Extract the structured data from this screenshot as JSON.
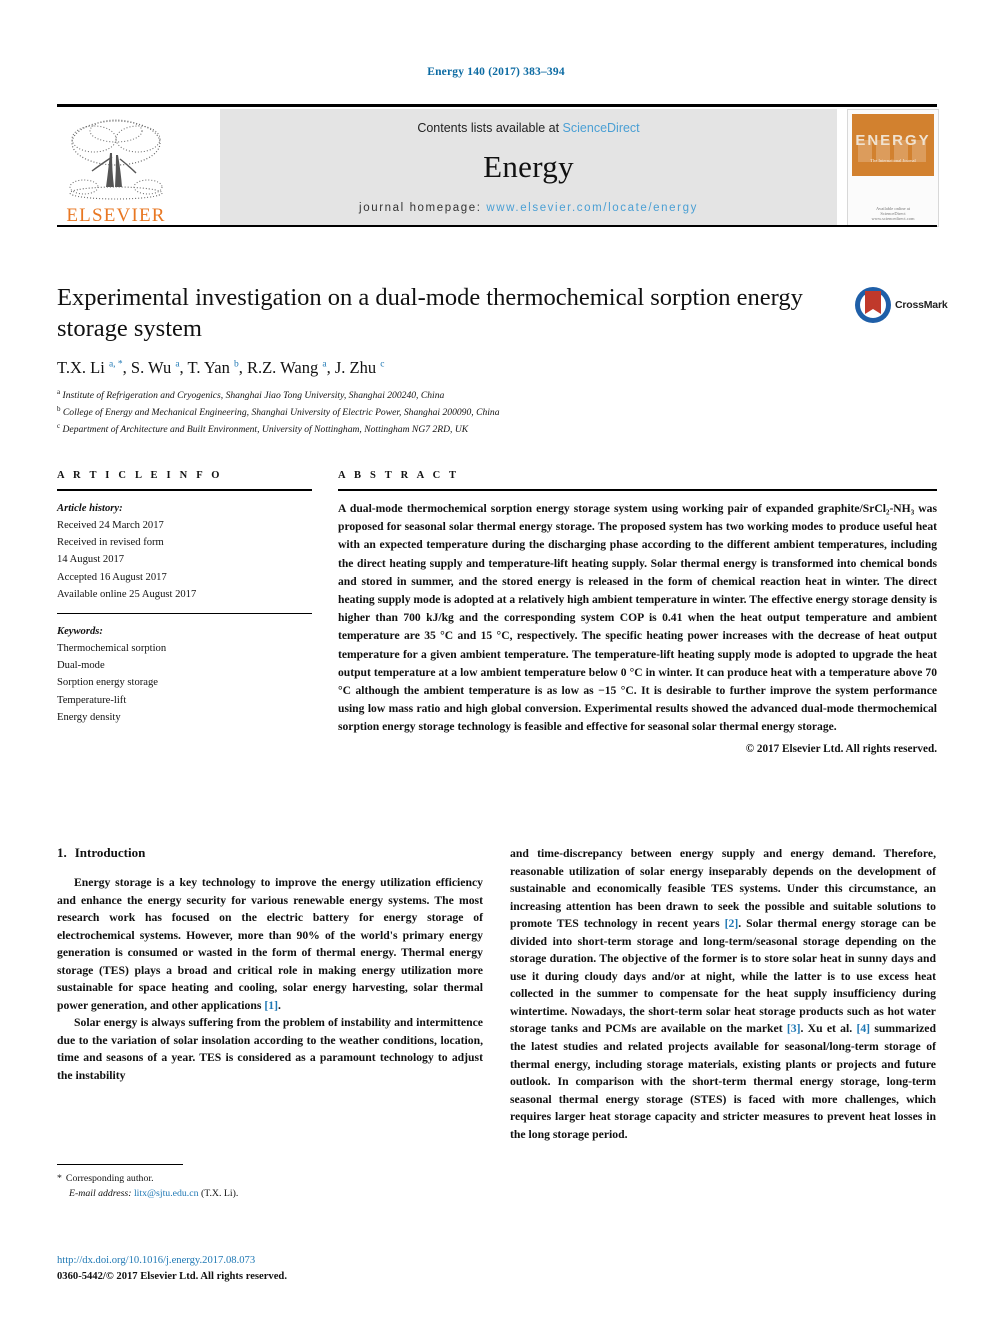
{
  "running_head": "Energy 140 (2017) 383–394",
  "masthead": {
    "contents_prefix": "Contents lists available at ",
    "contents_link": "ScienceDirect",
    "journal_title": "Energy",
    "homepage_prefix": "journal homepage: ",
    "homepage_url": "www.elsevier.com/locate/energy",
    "publisher_logo_text": "ELSEVIER",
    "cover": {
      "title": "ENERGY",
      "subtitle": "The International Journal",
      "footer": "Available online at\nScienceDirect\nwww.sciencedirect.com"
    },
    "accent_link_color": "#4a9fd4",
    "elsevier_orange": "#e87722"
  },
  "article": {
    "title": "Experimental investigation on a dual-mode thermochemical sorption energy storage system",
    "crossmark_label": "CrossMark",
    "authors_html": "T.X. Li <sup>a, *</sup>, S. Wu <sup>a</sup>, T. Yan <sup>b</sup>, R.Z. Wang <sup>a</sup>, J. Zhu <sup>c</sup>",
    "affiliations": [
      {
        "marker": "a",
        "text": "Institute of Refrigeration and Cryogenics, Shanghai Jiao Tong University, Shanghai 200240, China"
      },
      {
        "marker": "b",
        "text": "College of Energy and Mechanical Engineering, Shanghai University of Electric Power, Shanghai 200090, China"
      },
      {
        "marker": "c",
        "text": "Department of Architecture and Built Environment, University of Nottingham, Nottingham NG7 2RD, UK"
      }
    ]
  },
  "article_info": {
    "heading": "A R T I C L E   I N F O",
    "history_label": "Article history:",
    "history": [
      "Received 24 March 2017",
      "Received in revised form",
      "14 August 2017",
      "Accepted 16 August 2017",
      "Available online 25 August 2017"
    ],
    "keywords_label": "Keywords:",
    "keywords": [
      "Thermochemical sorption",
      "Dual-mode",
      "Sorption energy storage",
      "Temperature-lift",
      "Energy density"
    ]
  },
  "abstract": {
    "heading": "A B S T R A C T",
    "text": "A dual-mode thermochemical sorption energy storage system using working pair of expanded graphite/SrCl₂-NH₃ was proposed for seasonal solar thermal energy storage. The proposed system has two working modes to produce useful heat with an expected temperature during the discharging phase according to the different ambient temperatures, including the direct heating supply and temperature-lift heating supply. Solar thermal energy is transformed into chemical bonds and stored in summer, and the stored energy is released in the form of chemical reaction heat in winter. The direct heating supply mode is adopted at a relatively high ambient temperature in winter. The effective energy storage density is higher than 700 kJ/kg and the corresponding system COP is 0.41 when the heat output temperature and ambient temperature are 35 °C and 15 °C, respectively. The specific heating power increases with the decrease of heat output temperature for a given ambient temperature. The temperature-lift heating supply mode is adopted to upgrade the heat output temperature at a low ambient temperature below 0 °C in winter. It can produce heat with a temperature above 70 °C although the ambient temperature is as low as −15 °C. It is desirable to further improve the system performance using low mass ratio and high global conversion. Experimental results showed the advanced dual-mode thermochemical sorption energy storage technology is feasible and effective for seasonal solar thermal energy storage.",
    "copyright": "© 2017 Elsevier Ltd. All rights reserved."
  },
  "introduction": {
    "number": "1.",
    "title": "Introduction",
    "left_paragraphs": [
      "Energy storage is a key technology to improve the energy utilization efficiency and enhance the energy security for various renewable energy systems. The most research work has focused on the electric battery for energy storage of electrochemical systems. However, more than 90% of the world's primary energy generation is consumed or wasted in the form of thermal energy. Thermal energy storage (TES) plays a broad and critical role in making energy utilization more sustainable for space heating and cooling, solar energy harvesting, solar thermal power generation, and other applications [1].",
      "Solar energy is always suffering from the problem of instability and intermittence due to the variation of solar insolation according to the weather conditions, location, time and seasons of a year. TES is considered as a paramount technology to adjust the instability"
    ],
    "right_paragraphs": [
      "and time-discrepancy between energy supply and energy demand. Therefore, reasonable utilization of solar energy inseparably depends on the development of sustainable and economically feasible TES systems. Under this circumstance, an increasing attention has been drawn to seek the possible and suitable solutions to promote TES technology in recent years [2]. Solar thermal energy storage can be divided into short-term storage and long-term/seasonal storage depending on the storage duration. The objective of the former is to store solar heat in sunny days and use it during cloudy days and/or at night, while the latter is to use excess heat collected in the summer to compensate for the heat supply insufficiency during wintertime. Nowadays, the short-term solar heat storage products such as hot water storage tanks and PCMs are available on the market [3]. Xu et al. [4] summarized the latest studies and related projects available for seasonal/long-term storage of thermal energy, including storage materials, existing plants or projects and future outlook. In comparison with the short-term thermal energy storage, long-term seasonal thermal energy storage (STES) is faced with more challenges, which requires larger heat storage capacity and stricter measures to prevent heat losses in the long storage period."
    ]
  },
  "footnote": {
    "corresponding_marker": "*",
    "corresponding_text": "Corresponding author.",
    "email_label": "E-mail address:",
    "email": "litx@sjtu.edu.cn",
    "email_owner": "(T.X. Li)."
  },
  "footer": {
    "doi": "http://dx.doi.org/10.1016/j.energy.2017.08.073",
    "issn_line": "0360-5442/© 2017 Elsevier Ltd. All rights reserved."
  }
}
